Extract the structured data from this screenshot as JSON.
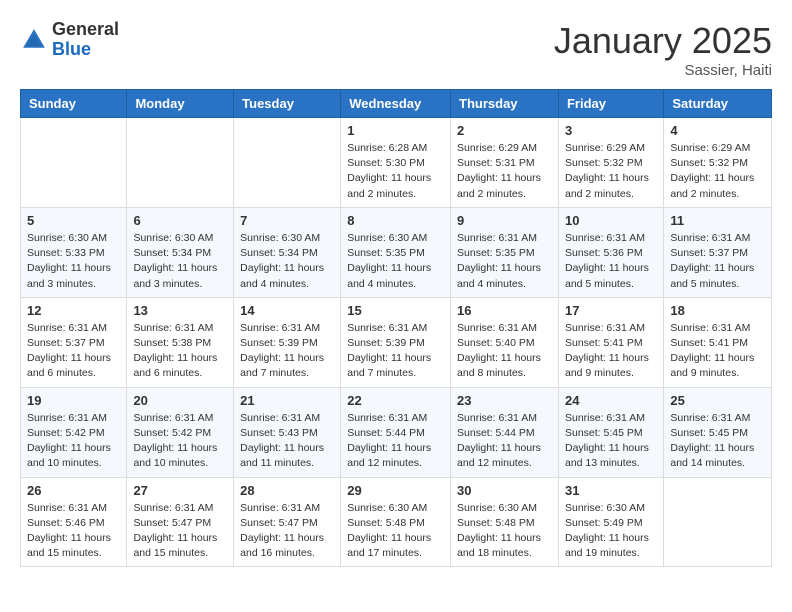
{
  "header": {
    "logo_general": "General",
    "logo_blue": "Blue",
    "month_title": "January 2025",
    "location": "Sassier, Haiti"
  },
  "days_of_week": [
    "Sunday",
    "Monday",
    "Tuesday",
    "Wednesday",
    "Thursday",
    "Friday",
    "Saturday"
  ],
  "weeks": [
    [
      {
        "day": "",
        "info": ""
      },
      {
        "day": "",
        "info": ""
      },
      {
        "day": "",
        "info": ""
      },
      {
        "day": "1",
        "info": "Sunrise: 6:28 AM\nSunset: 5:30 PM\nDaylight: 11 hours and 2 minutes."
      },
      {
        "day": "2",
        "info": "Sunrise: 6:29 AM\nSunset: 5:31 PM\nDaylight: 11 hours and 2 minutes."
      },
      {
        "day": "3",
        "info": "Sunrise: 6:29 AM\nSunset: 5:32 PM\nDaylight: 11 hours and 2 minutes."
      },
      {
        "day": "4",
        "info": "Sunrise: 6:29 AM\nSunset: 5:32 PM\nDaylight: 11 hours and 2 minutes."
      }
    ],
    [
      {
        "day": "5",
        "info": "Sunrise: 6:30 AM\nSunset: 5:33 PM\nDaylight: 11 hours and 3 minutes."
      },
      {
        "day": "6",
        "info": "Sunrise: 6:30 AM\nSunset: 5:34 PM\nDaylight: 11 hours and 3 minutes."
      },
      {
        "day": "7",
        "info": "Sunrise: 6:30 AM\nSunset: 5:34 PM\nDaylight: 11 hours and 4 minutes."
      },
      {
        "day": "8",
        "info": "Sunrise: 6:30 AM\nSunset: 5:35 PM\nDaylight: 11 hours and 4 minutes."
      },
      {
        "day": "9",
        "info": "Sunrise: 6:31 AM\nSunset: 5:35 PM\nDaylight: 11 hours and 4 minutes."
      },
      {
        "day": "10",
        "info": "Sunrise: 6:31 AM\nSunset: 5:36 PM\nDaylight: 11 hours and 5 minutes."
      },
      {
        "day": "11",
        "info": "Sunrise: 6:31 AM\nSunset: 5:37 PM\nDaylight: 11 hours and 5 minutes."
      }
    ],
    [
      {
        "day": "12",
        "info": "Sunrise: 6:31 AM\nSunset: 5:37 PM\nDaylight: 11 hours and 6 minutes."
      },
      {
        "day": "13",
        "info": "Sunrise: 6:31 AM\nSunset: 5:38 PM\nDaylight: 11 hours and 6 minutes."
      },
      {
        "day": "14",
        "info": "Sunrise: 6:31 AM\nSunset: 5:39 PM\nDaylight: 11 hours and 7 minutes."
      },
      {
        "day": "15",
        "info": "Sunrise: 6:31 AM\nSunset: 5:39 PM\nDaylight: 11 hours and 7 minutes."
      },
      {
        "day": "16",
        "info": "Sunrise: 6:31 AM\nSunset: 5:40 PM\nDaylight: 11 hours and 8 minutes."
      },
      {
        "day": "17",
        "info": "Sunrise: 6:31 AM\nSunset: 5:41 PM\nDaylight: 11 hours and 9 minutes."
      },
      {
        "day": "18",
        "info": "Sunrise: 6:31 AM\nSunset: 5:41 PM\nDaylight: 11 hours and 9 minutes."
      }
    ],
    [
      {
        "day": "19",
        "info": "Sunrise: 6:31 AM\nSunset: 5:42 PM\nDaylight: 11 hours and 10 minutes."
      },
      {
        "day": "20",
        "info": "Sunrise: 6:31 AM\nSunset: 5:42 PM\nDaylight: 11 hours and 10 minutes."
      },
      {
        "day": "21",
        "info": "Sunrise: 6:31 AM\nSunset: 5:43 PM\nDaylight: 11 hours and 11 minutes."
      },
      {
        "day": "22",
        "info": "Sunrise: 6:31 AM\nSunset: 5:44 PM\nDaylight: 11 hours and 12 minutes."
      },
      {
        "day": "23",
        "info": "Sunrise: 6:31 AM\nSunset: 5:44 PM\nDaylight: 11 hours and 12 minutes."
      },
      {
        "day": "24",
        "info": "Sunrise: 6:31 AM\nSunset: 5:45 PM\nDaylight: 11 hours and 13 minutes."
      },
      {
        "day": "25",
        "info": "Sunrise: 6:31 AM\nSunset: 5:45 PM\nDaylight: 11 hours and 14 minutes."
      }
    ],
    [
      {
        "day": "26",
        "info": "Sunrise: 6:31 AM\nSunset: 5:46 PM\nDaylight: 11 hours and 15 minutes."
      },
      {
        "day": "27",
        "info": "Sunrise: 6:31 AM\nSunset: 5:47 PM\nDaylight: 11 hours and 15 minutes."
      },
      {
        "day": "28",
        "info": "Sunrise: 6:31 AM\nSunset: 5:47 PM\nDaylight: 11 hours and 16 minutes."
      },
      {
        "day": "29",
        "info": "Sunrise: 6:30 AM\nSunset: 5:48 PM\nDaylight: 11 hours and 17 minutes."
      },
      {
        "day": "30",
        "info": "Sunrise: 6:30 AM\nSunset: 5:48 PM\nDaylight: 11 hours and 18 minutes."
      },
      {
        "day": "31",
        "info": "Sunrise: 6:30 AM\nSunset: 5:49 PM\nDaylight: 11 hours and 19 minutes."
      },
      {
        "day": "",
        "info": ""
      }
    ]
  ]
}
